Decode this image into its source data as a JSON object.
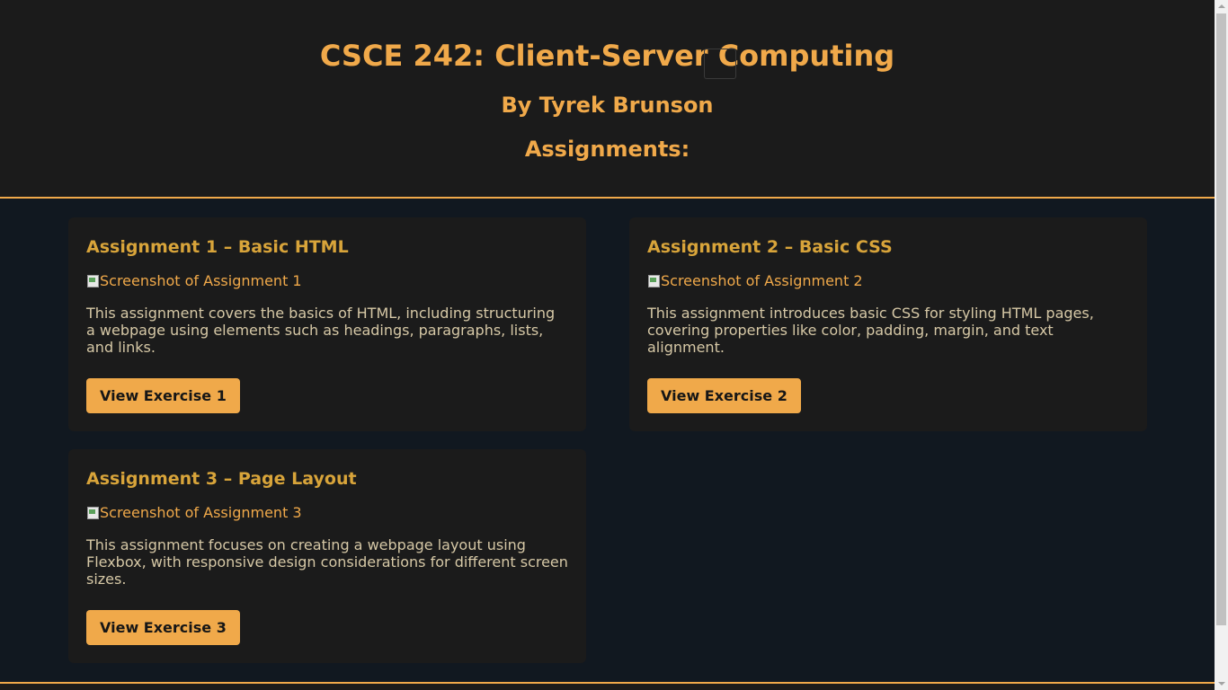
{
  "header": {
    "title": "CSCE 242: Client-Server Computing",
    "author": "By Tyrek Brunson",
    "section_heading": "Assignments:"
  },
  "assignments": [
    {
      "title": "Assignment 1 – Basic HTML",
      "image_alt": "Screenshot of Assignment 1",
      "description": "This assignment covers the basics of HTML, including structuring a webpage using elements such as headings, paragraphs, lists, and links.",
      "button_label": "View Exercise 1"
    },
    {
      "title": "Assignment 2 – Basic CSS",
      "image_alt": "Screenshot of Assignment 2",
      "description": "This assignment introduces basic CSS for styling HTML pages, covering properties like color, padding, margin, and text alignment.",
      "button_label": "View Exercise 2"
    },
    {
      "title": "Assignment 3 – Page Layout",
      "image_alt": "Screenshot of Assignment 3",
      "description": "This assignment focuses on creating a webpage layout using Flexbox, with responsive design considerations for different screen sizes.",
      "button_label": "View Exercise 3"
    }
  ],
  "colors": {
    "accent": "#f0a94a",
    "page_background": "#111820",
    "card_background": "#1b1b1b",
    "card_title": "#d8a43a",
    "body_text": "#d6c8a6"
  },
  "icons": {
    "image_placeholder": "broken-image-icon"
  }
}
